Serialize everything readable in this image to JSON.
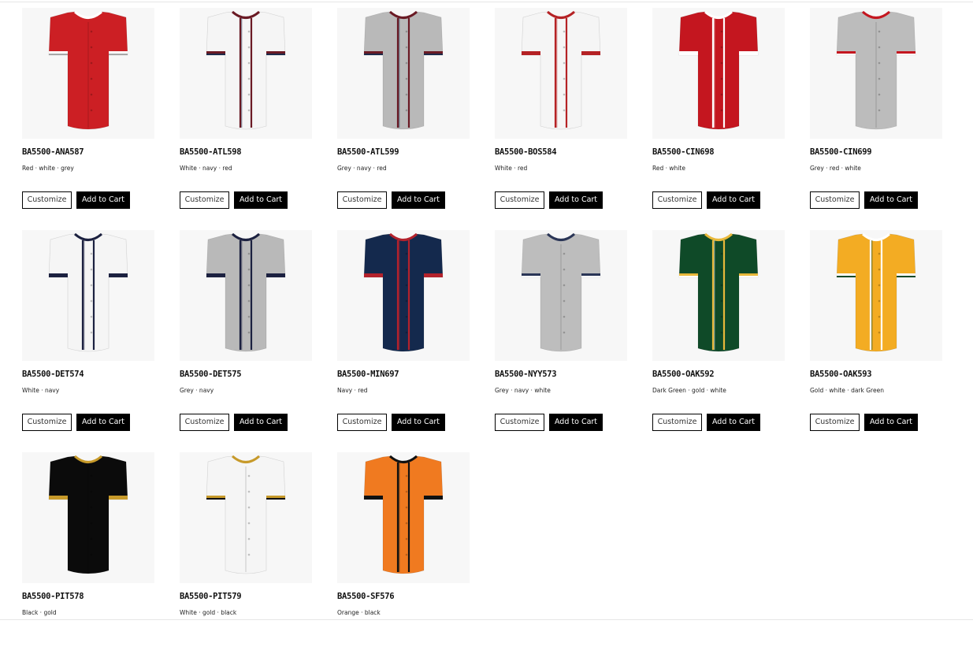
{
  "buttons": {
    "customize_label": "Customize",
    "cart_label": "Add to Cart"
  },
  "products": [
    {
      "sku": "BA5500-ANA587",
      "colors": "Red · white · grey",
      "body": "#cc1f24",
      "trim": [
        "#ffffff",
        "#a7a7a7"
      ],
      "piping": false,
      "icon": "red-jersey-image"
    },
    {
      "sku": "BA5500-ATL598",
      "colors": "White · navy · red",
      "body": "#f5f5f5",
      "trim": [
        "#6a1a24",
        "#1e2a4a"
      ],
      "piping": true,
      "icon": "white-jersey-image"
    },
    {
      "sku": "BA5500-ATL599",
      "colors": "Grey · navy · red",
      "body": "#b9b9b9",
      "trim": [
        "#6a1a24",
        "#1e2a4a"
      ],
      "piping": true,
      "icon": "grey-jersey-image"
    },
    {
      "sku": "BA5500-BOS584",
      "colors": "White · red",
      "body": "#f5f5f5",
      "trim": [
        "#b52225",
        "#b52225"
      ],
      "piping": true,
      "icon": "white-jersey-image"
    },
    {
      "sku": "BA5500-CIN698",
      "colors": "Red · white",
      "body": "#c4161f",
      "trim": [
        "#ffffff",
        "#ffffff"
      ],
      "piping": true,
      "icon": "red-jersey-image"
    },
    {
      "sku": "BA5500-CIN699",
      "colors": "Grey · red · white",
      "body": "#bcbcbc",
      "trim": [
        "#c4161f",
        "#ffffff"
      ],
      "piping": false,
      "icon": "grey-jersey-image"
    },
    {
      "sku": "BA5500-DET574",
      "colors": "White · navy",
      "body": "#f5f5f5",
      "trim": [
        "#1c2140",
        "#1c2140"
      ],
      "piping": true,
      "icon": "white-jersey-image"
    },
    {
      "sku": "BA5500-DET575",
      "colors": "Grey · navy",
      "body": "#b9b9b9",
      "trim": [
        "#1c2140",
        "#1c2140"
      ],
      "piping": true,
      "icon": "grey-jersey-image"
    },
    {
      "sku": "BA5500-MIN697",
      "colors": "Navy · red",
      "body": "#14294d",
      "trim": [
        "#b3222c",
        "#b3222c"
      ],
      "piping": true,
      "icon": "navy-jersey-image"
    },
    {
      "sku": "BA5500-NYY573",
      "colors": "Grey · navy · white",
      "body": "#bdbdbd",
      "trim": [
        "#2a3556",
        "#ffffff"
      ],
      "piping": false,
      "icon": "grey-jersey-image"
    },
    {
      "sku": "BA5500-OAK592",
      "colors": "Dark Green · gold · white",
      "body": "#0f4a28",
      "trim": [
        "#e8b83a",
        "#ffffff"
      ],
      "piping": true,
      "icon": "green-jersey-image"
    },
    {
      "sku": "BA5500-OAK593",
      "colors": "Gold · white · dark Green",
      "body": "#f3ac23",
      "trim": [
        "#ffffff",
        "#0f4a28"
      ],
      "piping": true,
      "icon": "gold-jersey-image"
    },
    {
      "sku": "BA5500-PIT578",
      "colors": "Black · gold",
      "body": "#0b0b0b",
      "trim": [
        "#c79a2a",
        "#c79a2a"
      ],
      "piping": false,
      "icon": "black-jersey-image"
    },
    {
      "sku": "BA5500-PIT579",
      "colors": "White · gold · black",
      "body": "#f5f5f5",
      "trim": [
        "#c79a2a",
        "#111111"
      ],
      "piping": false,
      "icon": "white-jersey-image"
    },
    {
      "sku": "BA5500-SF576",
      "colors": "Orange · black",
      "body": "#f07a20",
      "trim": [
        "#111111",
        "#111111"
      ],
      "piping": true,
      "icon": "orange-jersey-image"
    }
  ]
}
